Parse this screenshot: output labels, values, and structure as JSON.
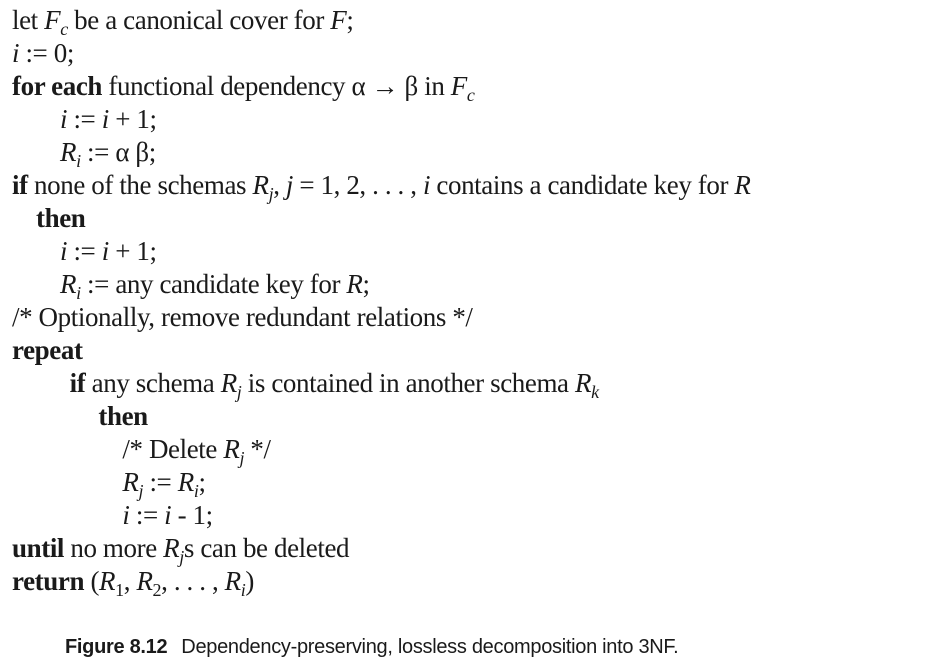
{
  "algorithm": {
    "lines": [
      {
        "indent": 0,
        "segs": [
          [
            "n",
            "let "
          ],
          [
            "i",
            "F"
          ],
          [
            "sub",
            "c"
          ],
          [
            "n",
            " be a canonical cover for "
          ],
          [
            "i",
            "F"
          ],
          [
            "n",
            ";"
          ]
        ]
      },
      {
        "indent": 0,
        "segs": [
          [
            "i",
            "i"
          ],
          [
            "n",
            " := 0;"
          ]
        ]
      },
      {
        "indent": 0,
        "segs": [
          [
            "b",
            "for each"
          ],
          [
            "n",
            " functional dependency α → β in "
          ],
          [
            "i",
            "F"
          ],
          [
            "sub",
            "c"
          ]
        ]
      },
      {
        "indent": 1,
        "segs": [
          [
            "i",
            "i"
          ],
          [
            "n",
            " := "
          ],
          [
            "i",
            "i"
          ],
          [
            "n",
            " + 1;"
          ]
        ]
      },
      {
        "indent": 1,
        "segs": [
          [
            "i",
            "R"
          ],
          [
            "sub",
            "i"
          ],
          [
            "n",
            " := α β;"
          ]
        ]
      },
      {
        "indent": 0,
        "segs": [
          [
            "b",
            "if"
          ],
          [
            "n",
            " none of the schemas "
          ],
          [
            "i",
            "R"
          ],
          [
            "sub",
            "j"
          ],
          [
            "n",
            ", "
          ],
          [
            "i",
            "j"
          ],
          [
            "n",
            " = 1, 2, . . . , "
          ],
          [
            "i",
            "i"
          ],
          [
            "n",
            " contains a candidate key for "
          ],
          [
            "i",
            "R"
          ]
        ]
      },
      {
        "indent": 0.5,
        "segs": [
          [
            "b",
            "then"
          ]
        ]
      },
      {
        "indent": 1,
        "segs": [
          [
            "i",
            "i"
          ],
          [
            "n",
            " := "
          ],
          [
            "i",
            "i"
          ],
          [
            "n",
            " + 1;"
          ]
        ]
      },
      {
        "indent": 1,
        "segs": [
          [
            "i",
            "R"
          ],
          [
            "sub",
            "i"
          ],
          [
            "n",
            " := any candidate key for "
          ],
          [
            "i",
            "R"
          ],
          [
            "n",
            ";"
          ]
        ]
      },
      {
        "indent": 0,
        "segs": [
          [
            "n",
            "/* Optionally, remove redundant relations */"
          ]
        ]
      },
      {
        "indent": 0,
        "segs": [
          [
            "b",
            "repeat"
          ]
        ]
      },
      {
        "indent": 1.2,
        "segs": [
          [
            "b",
            "if"
          ],
          [
            "n",
            " any schema "
          ],
          [
            "i",
            "R"
          ],
          [
            "sub",
            "j"
          ],
          [
            "n",
            " is contained in another schema "
          ],
          [
            "i",
            "R"
          ],
          [
            "sub",
            "k"
          ]
        ]
      },
      {
        "indent": 1.8,
        "segs": [
          [
            "b",
            "then"
          ]
        ]
      },
      {
        "indent": 2.3,
        "segs": [
          [
            "n",
            "/* Delete "
          ],
          [
            "i",
            "R"
          ],
          [
            "sub",
            "j"
          ],
          [
            "n",
            " */"
          ]
        ]
      },
      {
        "indent": 2.3,
        "segs": [
          [
            "i",
            "R"
          ],
          [
            "sub",
            "j"
          ],
          [
            "n",
            " := "
          ],
          [
            "i",
            "R"
          ],
          [
            "sub",
            "i"
          ],
          [
            "n",
            ";"
          ]
        ]
      },
      {
        "indent": 2.3,
        "segs": [
          [
            "i",
            "i"
          ],
          [
            "n",
            " := "
          ],
          [
            "i",
            "i"
          ],
          [
            "n",
            " - 1;"
          ]
        ]
      },
      {
        "indent": 0,
        "segs": [
          [
            "b",
            "until"
          ],
          [
            "n",
            " no more "
          ],
          [
            "i",
            "R"
          ],
          [
            "sub",
            "j"
          ],
          [
            "n",
            "s can be deleted"
          ]
        ]
      },
      {
        "indent": 0,
        "segs": [
          [
            "b",
            "return"
          ],
          [
            "n",
            " ("
          ],
          [
            "i",
            "R"
          ],
          [
            "subn",
            "1"
          ],
          [
            "n",
            ", "
          ],
          [
            "i",
            "R"
          ],
          [
            "subn",
            "2"
          ],
          [
            "n",
            ", . . . , "
          ],
          [
            "i",
            "R"
          ],
          [
            "sub",
            "i"
          ],
          [
            "n",
            ")"
          ]
        ]
      }
    ]
  },
  "caption": {
    "figure_label": "Figure 8.12",
    "text": "Dependency-preserving, lossless decomposition into 3NF."
  }
}
